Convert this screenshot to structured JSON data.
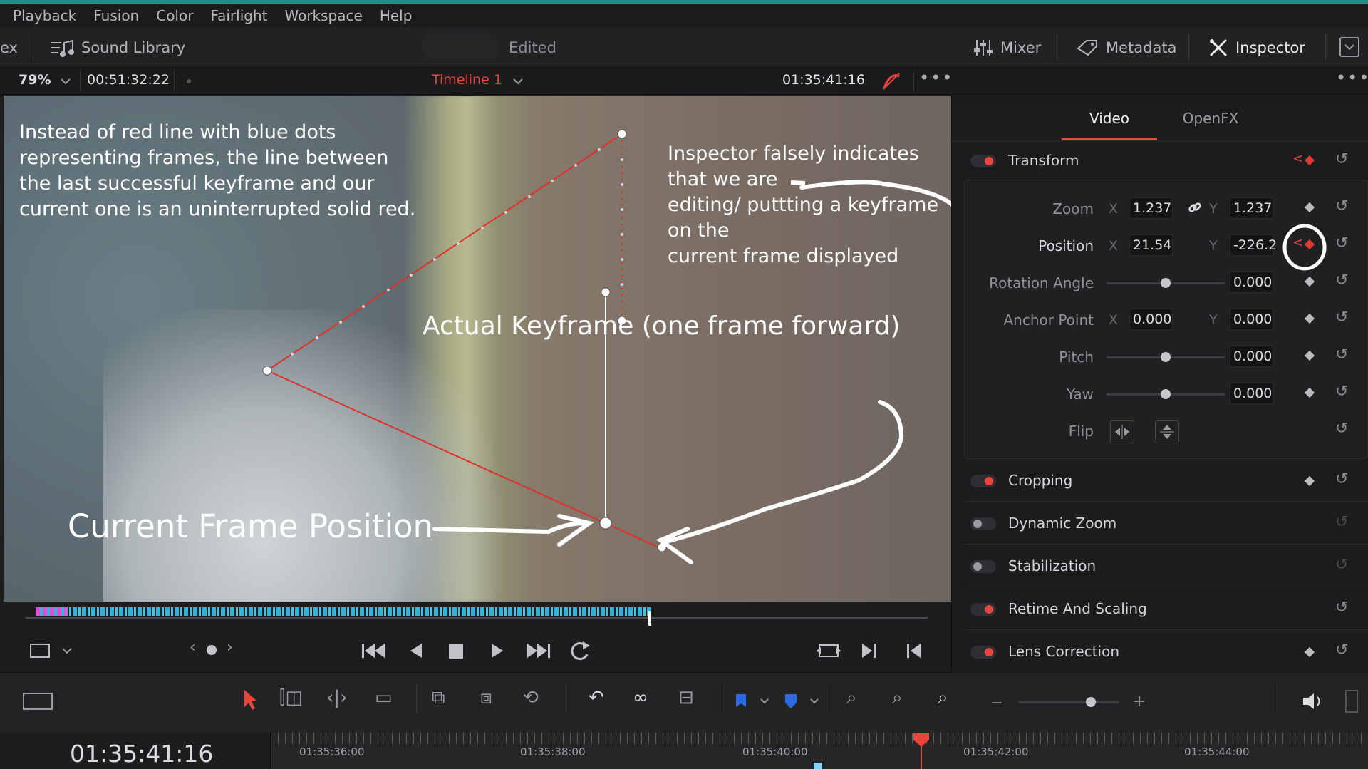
{
  "menu": [
    "Playback",
    "Fusion",
    "Color",
    "Fairlight",
    "Workspace",
    "Help"
  ],
  "toolbar": {
    "partial_left": "ex",
    "sound_library": "Sound Library",
    "status": "Edited",
    "mixer": "Mixer",
    "metadata": "Metadata",
    "inspector": "Inspector"
  },
  "viewer": {
    "zoom": "79%",
    "source_timecode": "00:51:32:22",
    "timeline_name": "Timeline 1",
    "timecode": "01:35:41:16"
  },
  "annotations": {
    "left_note": [
      "Instead of red line with blue dots",
      "representing frames, the line between",
      "the last successful keyframe and our",
      "current one is an uninterrupted solid red."
    ],
    "right_note": [
      "Inspector falsely indicates that we are",
      "editing/ puttting a keyframe on the",
      "current frame displayed"
    ],
    "actual_keyframe": "Actual Keyframe (one frame forward)",
    "current_frame": "Current Frame Position"
  },
  "inspector": {
    "tabs": [
      "Video",
      "OpenFX"
    ],
    "active_tab": "Video",
    "transform": {
      "title": "Transform",
      "zoom": {
        "label": "Zoom",
        "x_axis": "X",
        "x": "1.237",
        "y_axis": "Y",
        "y": "1.237"
      },
      "position": {
        "label": "Position",
        "x_axis": "X",
        "x": "21.54(",
        "y_axis": "Y",
        "y": "-226.2"
      },
      "rotation": {
        "label": "Rotation Angle",
        "value": "0.000"
      },
      "anchor": {
        "label": "Anchor Point",
        "x_axis": "X",
        "x": "0.000",
        "y_axis": "Y",
        "y": "0.000"
      },
      "pitch": {
        "label": "Pitch",
        "value": "0.000"
      },
      "yaw": {
        "label": "Yaw",
        "value": "0.000"
      },
      "flip": {
        "label": "Flip"
      }
    },
    "sections": [
      "Cropping",
      "Dynamic Zoom",
      "Stabilization",
      "Retime And Scaling",
      "Lens Correction"
    ]
  },
  "timeline": {
    "current_timecode": "01:35:41:16",
    "ruler": [
      "01:35:36:00",
      "01:35:38:00",
      "01:35:40:00",
      "01:35:42:00",
      "01:35:44:00"
    ]
  },
  "colors": {
    "accent_red": "#e23a33",
    "teal": "#1f8e8a",
    "playhead": "#e8453c"
  }
}
